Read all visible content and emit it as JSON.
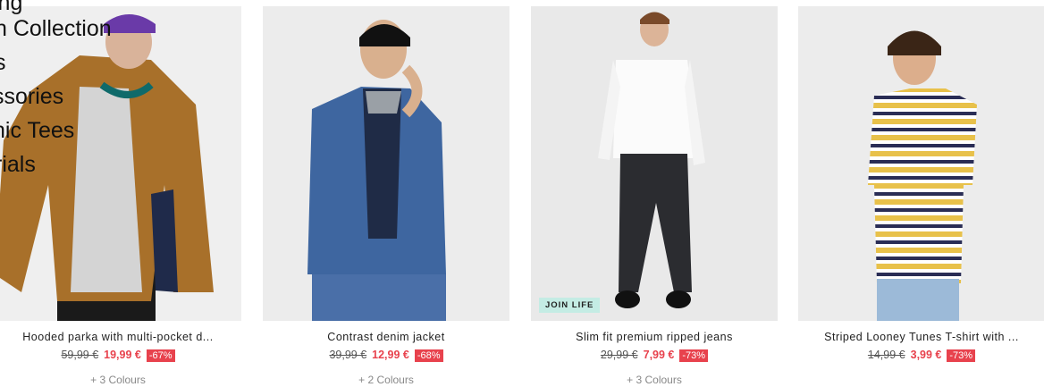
{
  "menu": [
    "ing",
    "n Collection",
    "s",
    "ssories",
    "nic Tees",
    "rials"
  ],
  "products": [
    {
      "name": "Hooded parka with multi-pocket d...",
      "old_price": "59,99 €",
      "price": "19,99 €",
      "discount": "-67%",
      "colours": "+ 3 Colours",
      "badge": ""
    },
    {
      "name": "Contrast denim jacket",
      "old_price": "39,99 €",
      "price": "12,99 €",
      "discount": "-68%",
      "colours": "+ 2 Colours",
      "badge": ""
    },
    {
      "name": "Slim fit premium ripped jeans",
      "old_price": "29,99 €",
      "price": "7,99 €",
      "discount": "-73%",
      "colours": "+ 3 Colours",
      "badge": "JOIN LIFE"
    },
    {
      "name": "Striped Looney Tunes T-shirt with ...",
      "old_price": "14,99 €",
      "price": "3,99 €",
      "discount": "-73%",
      "colours": "",
      "badge": ""
    }
  ],
  "colors": {
    "sale_red": "#e8424d",
    "badge_bg": "#c4ece4",
    "photo_bg": "#ececec"
  }
}
